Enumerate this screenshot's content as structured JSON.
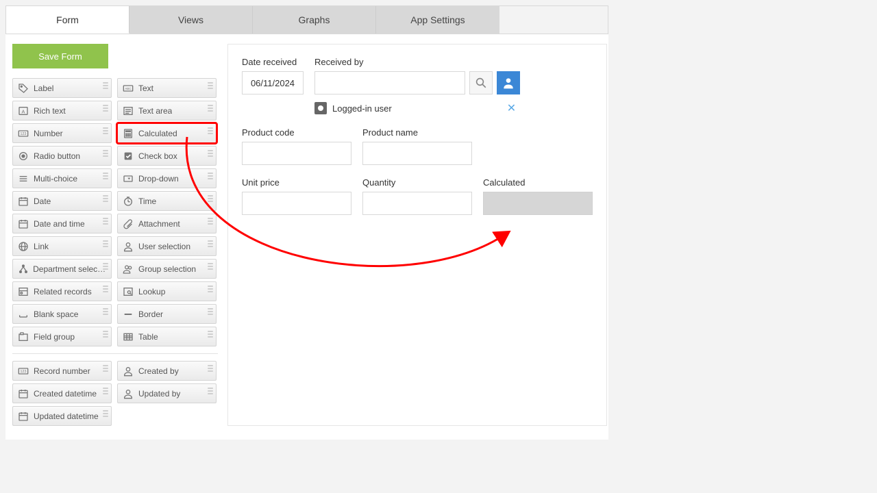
{
  "tabs": {
    "form": "Form",
    "views": "Views",
    "graphs": "Graphs",
    "settings": "App Settings"
  },
  "save_label": "Save Form",
  "palette_left": [
    {
      "icon": "tag",
      "label": "Label"
    },
    {
      "icon": "A",
      "label": "Rich text"
    },
    {
      "icon": "123",
      "label": "Number"
    },
    {
      "icon": "radio",
      "label": "Radio button"
    },
    {
      "icon": "list",
      "label": "Multi-choice"
    },
    {
      "icon": "cal",
      "label": "Date"
    },
    {
      "icon": "cal",
      "label": "Date and time"
    },
    {
      "icon": "globe",
      "label": "Link"
    },
    {
      "icon": "tree",
      "label": "Department selection"
    },
    {
      "icon": "rel",
      "label": "Related records"
    },
    {
      "icon": "blank",
      "label": "Blank space"
    },
    {
      "icon": "group",
      "label": "Field group"
    }
  ],
  "palette_right": [
    {
      "icon": "abc",
      "label": "Text"
    },
    {
      "icon": "lines",
      "label": "Text area"
    },
    {
      "icon": "calc",
      "label": "Calculated",
      "hl": true
    },
    {
      "icon": "check",
      "label": "Check box"
    },
    {
      "icon": "drop",
      "label": "Drop-down"
    },
    {
      "icon": "clock",
      "label": "Time"
    },
    {
      "icon": "clip",
      "label": "Attachment"
    },
    {
      "icon": "user",
      "label": "User selection"
    },
    {
      "icon": "users",
      "label": "Group selection"
    },
    {
      "icon": "lookup",
      "label": "Lookup"
    },
    {
      "icon": "border",
      "label": "Border"
    },
    {
      "icon": "table",
      "label": "Table"
    }
  ],
  "palette_sys_left": [
    {
      "icon": "123",
      "label": "Record number"
    },
    {
      "icon": "cal",
      "label": "Created datetime"
    },
    {
      "icon": "cal",
      "label": "Updated datetime"
    }
  ],
  "palette_sys_right": [
    {
      "icon": "user",
      "label": "Created by"
    },
    {
      "icon": "user",
      "label": "Updated by"
    }
  ],
  "form": {
    "date_received": {
      "label": "Date received",
      "value": "06/11/2024"
    },
    "received_by": {
      "label": "Received by",
      "value": ""
    },
    "logged_in": "Logged-in user",
    "product_code": {
      "label": "Product code",
      "value": ""
    },
    "product_name": {
      "label": "Product name",
      "value": ""
    },
    "unit_price": {
      "label": "Unit price",
      "value": ""
    },
    "quantity": {
      "label": "Quantity",
      "value": ""
    },
    "calculated": {
      "label": "Calculated",
      "value": ""
    }
  }
}
